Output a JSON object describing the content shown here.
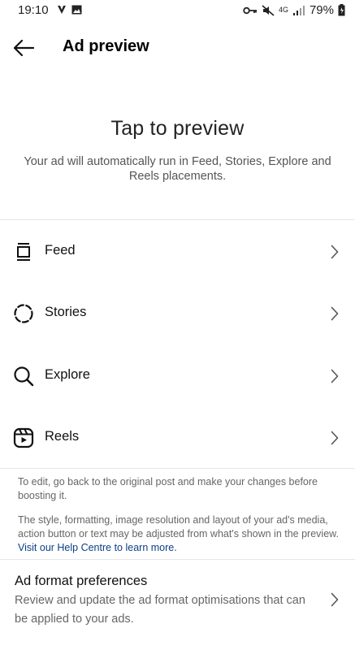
{
  "status_bar": {
    "time": "19:10",
    "network": "4G",
    "battery": "79%",
    "icons": [
      "vpn-v-icon",
      "gallery-icon",
      "key-icon",
      "mute-icon",
      "signal-icon",
      "battery-icon"
    ]
  },
  "header": {
    "title": "Ad preview",
    "back_icon": "arrow-left-icon"
  },
  "hero": {
    "title": "Tap to preview",
    "subtitle": "Your ad will automatically run in Feed, Stories, Explore and Reels placements."
  },
  "placements": [
    {
      "label": "Feed",
      "icon": "feed-icon"
    },
    {
      "label": "Stories",
      "icon": "stories-icon"
    },
    {
      "label": "Explore",
      "icon": "search-icon"
    },
    {
      "label": "Reels",
      "icon": "reels-icon"
    }
  ],
  "notes": {
    "edit_note": "To edit, go back to the original post and make your changes before boosting it.",
    "style_note": "The style, formatting, image resolution and layout of your ad's media, action button or text may be adjusted from what's shown in the preview.",
    "help_link": "Visit our Help Centre to learn more."
  },
  "ad_format": {
    "title": "Ad format preferences",
    "description": "Review and update the ad format optimisations that can be applied to your ads."
  },
  "colors": {
    "link": "#0b3f87",
    "text_primary": "#111111",
    "text_secondary": "#666666",
    "divider": "#e6e6e6"
  }
}
